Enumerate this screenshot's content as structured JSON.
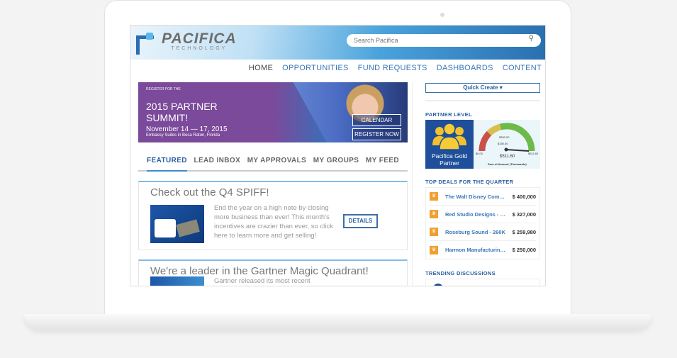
{
  "header": {
    "logo": "PACIFICA",
    "logo_sub": "TECHNOLOGY",
    "search_placeholder": "Search Pacifica"
  },
  "nav": [
    "HOME",
    "OPPORTUNITIES",
    "FUND REQUESTS",
    "DASHBOARDS",
    "CONTENT"
  ],
  "banner": {
    "small": "REGISTER FOR THE",
    "title1": "2015 PARTNER",
    "title2": "SUMMIT!",
    "date": "November 14 — 17, 2015",
    "location": "Embassy Suites in Boca Raton, Florida",
    "calendar": "CALENDAR",
    "register": "REGISTER NOW"
  },
  "tabs": [
    "FEATURED",
    "LEAD INBOX",
    "MY APPROVALS",
    "MY GROUPS",
    "MY FEED"
  ],
  "cards": [
    {
      "title": "Check out the Q4 SPIFF!",
      "body": "End the year on a high note by closing more business than ever! This month's incentives are crazier than ever, so click here to learn more and get selling!",
      "button": "DETAILS"
    },
    {
      "title": "We're a leader in the Gartner Magic Quadrant!",
      "body": "Gartner released its most recent"
    }
  ],
  "sidebar": {
    "quick_create": "Quick Create ▾",
    "partner_level_title": "PARTNER LEVEL",
    "partner_level": "Pacifica Gold Partner",
    "gauge": {
      "min": "$0.00",
      "l1": "$150.00",
      "l2": "$250.00",
      "max": "$511.60",
      "value": "$511.60",
      "caption": "Sum of Amount (Thousands)",
      "colors": [
        "#c9514a",
        "#d9c04e",
        "#6db94a"
      ]
    },
    "top_deals_title": "TOP DEALS FOR THE QUARTER",
    "deals": [
      {
        "name": "The Walt Disney Comp...",
        "amount": "$ 400,000"
      },
      {
        "name": "Red Studio Designs - 3...",
        "amount": "$ 327,000"
      },
      {
        "name": "Roseburg Sound - 260K",
        "amount": "$ 259,980"
      },
      {
        "name": "Harmon Manufacturing...",
        "amount": "$ 250,000"
      }
    ],
    "trending_title": "TRENDING DISCUSSIONS"
  }
}
